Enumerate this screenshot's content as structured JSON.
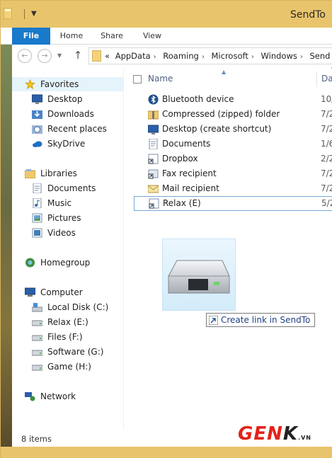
{
  "window": {
    "title": "SendTo"
  },
  "ribbon": {
    "tabs": [
      "File",
      "Home",
      "Share",
      "View"
    ]
  },
  "address": {
    "prefix": "«",
    "crumbs": [
      "AppData",
      "Roaming",
      "Microsoft",
      "Windows",
      "Send"
    ]
  },
  "nav": {
    "favorites": {
      "header": "Favorites",
      "items": [
        "Desktop",
        "Downloads",
        "Recent places",
        "SkyDrive"
      ]
    },
    "libraries": {
      "header": "Libraries",
      "items": [
        "Documents",
        "Music",
        "Pictures",
        "Videos"
      ]
    },
    "homegroup": "Homegroup",
    "computer": {
      "header": "Computer",
      "items": [
        "Local Disk (C:)",
        "Relax (E:)",
        "Files (F:)",
        "Software (G:)",
        "Game (H:)"
      ]
    },
    "network": "Network"
  },
  "columns": {
    "name": "Name",
    "date": "Dat"
  },
  "files": [
    {
      "name": "Bluetooth device",
      "date": "10/",
      "icon": "bluetooth-icon"
    },
    {
      "name": "Compressed (zipped) folder",
      "date": "7/2",
      "icon": "zip-folder-icon"
    },
    {
      "name": "Desktop (create shortcut)",
      "date": "7/2",
      "icon": "desktop-icon"
    },
    {
      "name": "Documents",
      "date": "1/6",
      "icon": "document-icon"
    },
    {
      "name": "Dropbox",
      "date": "2/2",
      "icon": "shortcut-icon"
    },
    {
      "name": "Fax recipient",
      "date": "7/2",
      "icon": "fax-icon"
    },
    {
      "name": "Mail recipient",
      "date": "7/2",
      "icon": "mail-icon"
    },
    {
      "name": "Relax (E)",
      "date": "5/2",
      "icon": "shortcut-icon"
    }
  ],
  "drag": {
    "tooltip": "Create link in SendTo"
  },
  "status": {
    "count": "8 items"
  },
  "watermark": {
    "brand_red": "GEN",
    "brand_black": "K",
    "suffix": ".VN"
  },
  "colors": {
    "titlebar": "#e8c46c",
    "file_tab": "#1979ca",
    "selection": "#e5f3fb",
    "focus_border": "#7aa7d8"
  }
}
